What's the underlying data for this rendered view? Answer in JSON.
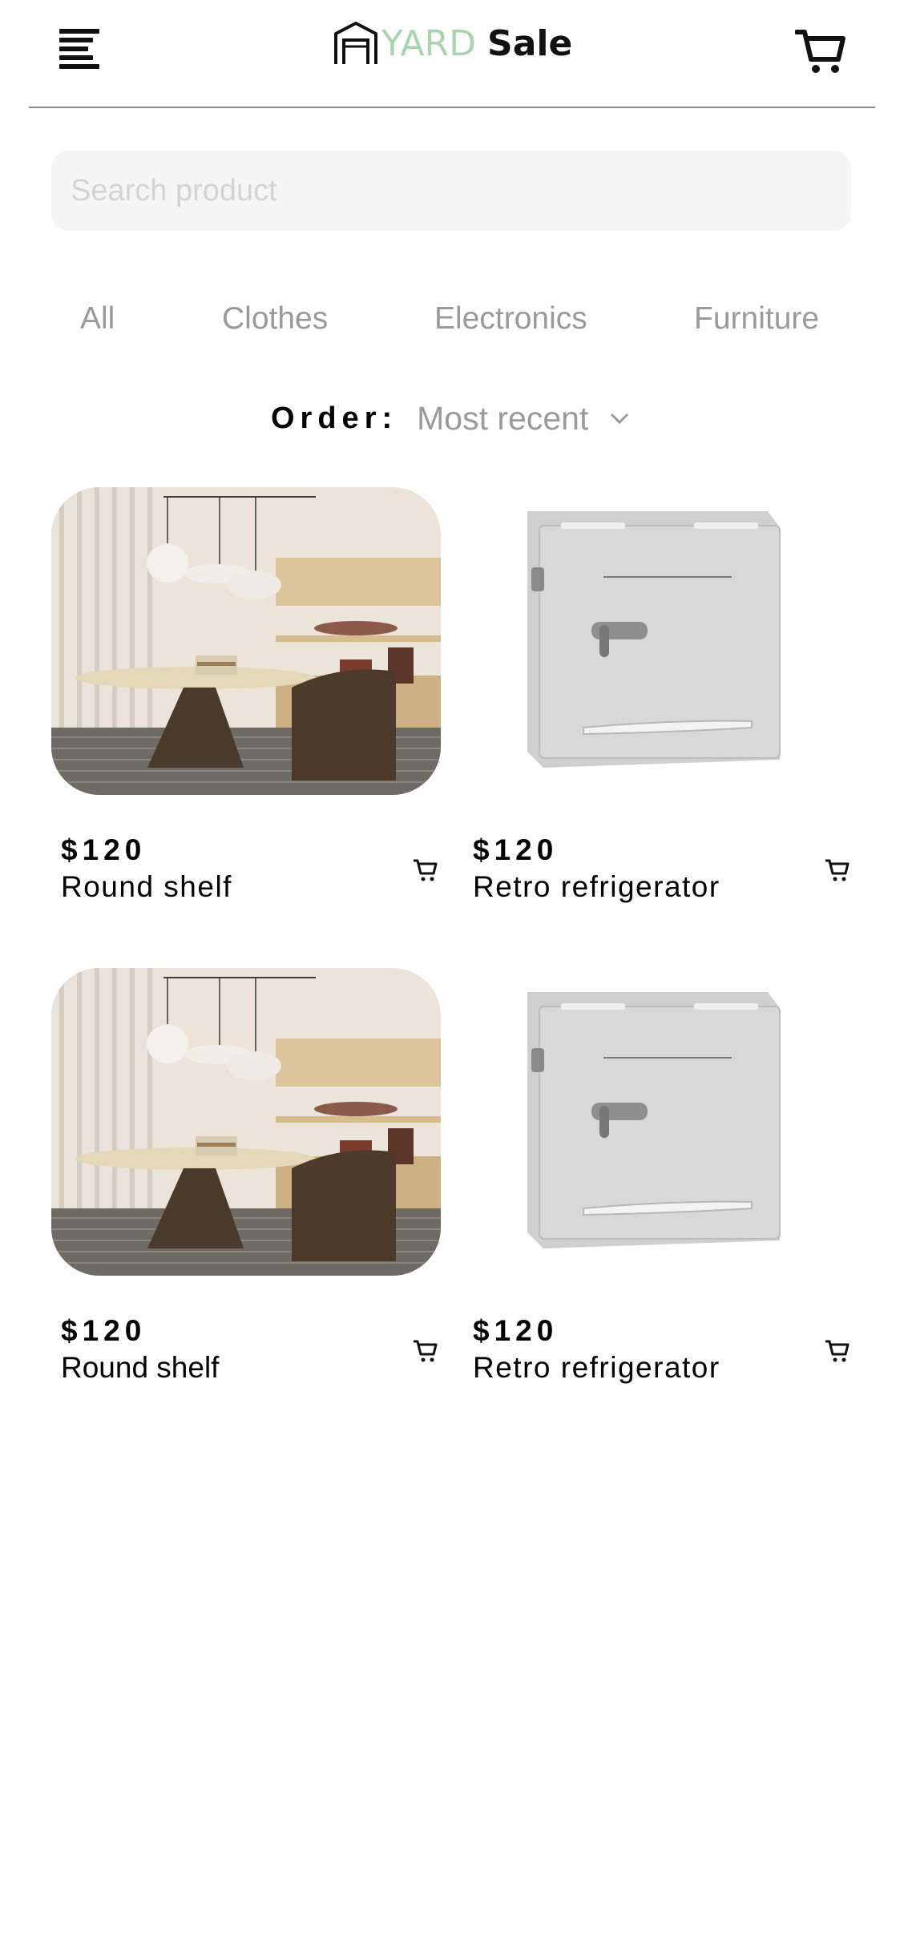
{
  "header": {
    "brand_first": "YARD",
    "brand_second": "Sale",
    "menu_icon": "hamburger-menu-icon",
    "cart_icon": "shopping-cart-icon",
    "brand_color": "#a8d5b0"
  },
  "search": {
    "placeholder": "Search product",
    "value": ""
  },
  "categories": [
    "All",
    "Clothes",
    "Electronics",
    "Furniture"
  ],
  "order": {
    "label": "Order:",
    "selected": "Most recent"
  },
  "products": [
    {
      "price": "$120",
      "name": "Round shelf",
      "image": "round-shelf-image"
    },
    {
      "price": "$120",
      "name": "Retro refrigerator",
      "image": "retro-refrigerator-image"
    },
    {
      "price": "$120",
      "name": "Round shelf",
      "image": "round-shelf-image"
    },
    {
      "price": "$120",
      "name": "Retro refrigerator",
      "image": "retro-refrigerator-image"
    }
  ]
}
